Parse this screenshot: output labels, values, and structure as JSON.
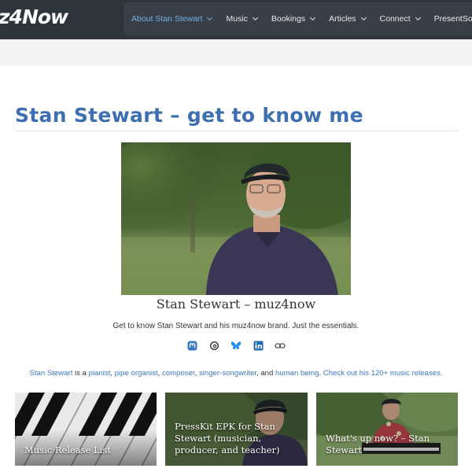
{
  "header": {
    "logo_text": "z4Now",
    "nav": [
      {
        "label": "About Stan Stewart",
        "active": true,
        "has_dropdown": true
      },
      {
        "label": "Music",
        "active": false,
        "has_dropdown": true
      },
      {
        "label": "Bookings",
        "active": false,
        "has_dropdown": true
      },
      {
        "label": "Articles",
        "active": false,
        "has_dropdown": true
      },
      {
        "label": "Connect",
        "active": false,
        "has_dropdown": true
      },
      {
        "label": "PresentSongs",
        "active": false,
        "has_dropdown": false
      }
    ]
  },
  "page": {
    "title": "Stan Stewart – get to know me",
    "caption": "Stan Stewart – muz4now",
    "tagline": "Get to know Stan Stewart and his muz4now brand. Just the essentials."
  },
  "social": [
    {
      "icon": "mastodon-icon"
    },
    {
      "icon": "threads-icon"
    },
    {
      "icon": "bluesky-icon"
    },
    {
      "icon": "linkedin-icon"
    },
    {
      "icon": "link-icon"
    }
  ],
  "intro": {
    "name_link": "Stan Stewart",
    "is_a": " is a ",
    "pianist": "pianist",
    "sep1": ", ",
    "pipe_organist": "pipe organist",
    "sep2": ", ",
    "composer": "composer",
    "sep3": ", ",
    "singer_songwriter": "singer-songwriter",
    "and": ", and ",
    "human_being": "human being",
    "space": ". ",
    "releases_link": "Check out his 120+ music releases",
    "end": "."
  },
  "cards": [
    {
      "label": "Music Release List"
    },
    {
      "label": "PressKit EPK for Stan Stewart (musician, producer, and teacher)"
    },
    {
      "label": "What's up now? – Stan Stewart"
    }
  ],
  "colors": {
    "header_bg": "#2f333a",
    "accent": "#3d6fb0",
    "link": "#3a78c3",
    "nav_active": "#6fb0e6"
  }
}
